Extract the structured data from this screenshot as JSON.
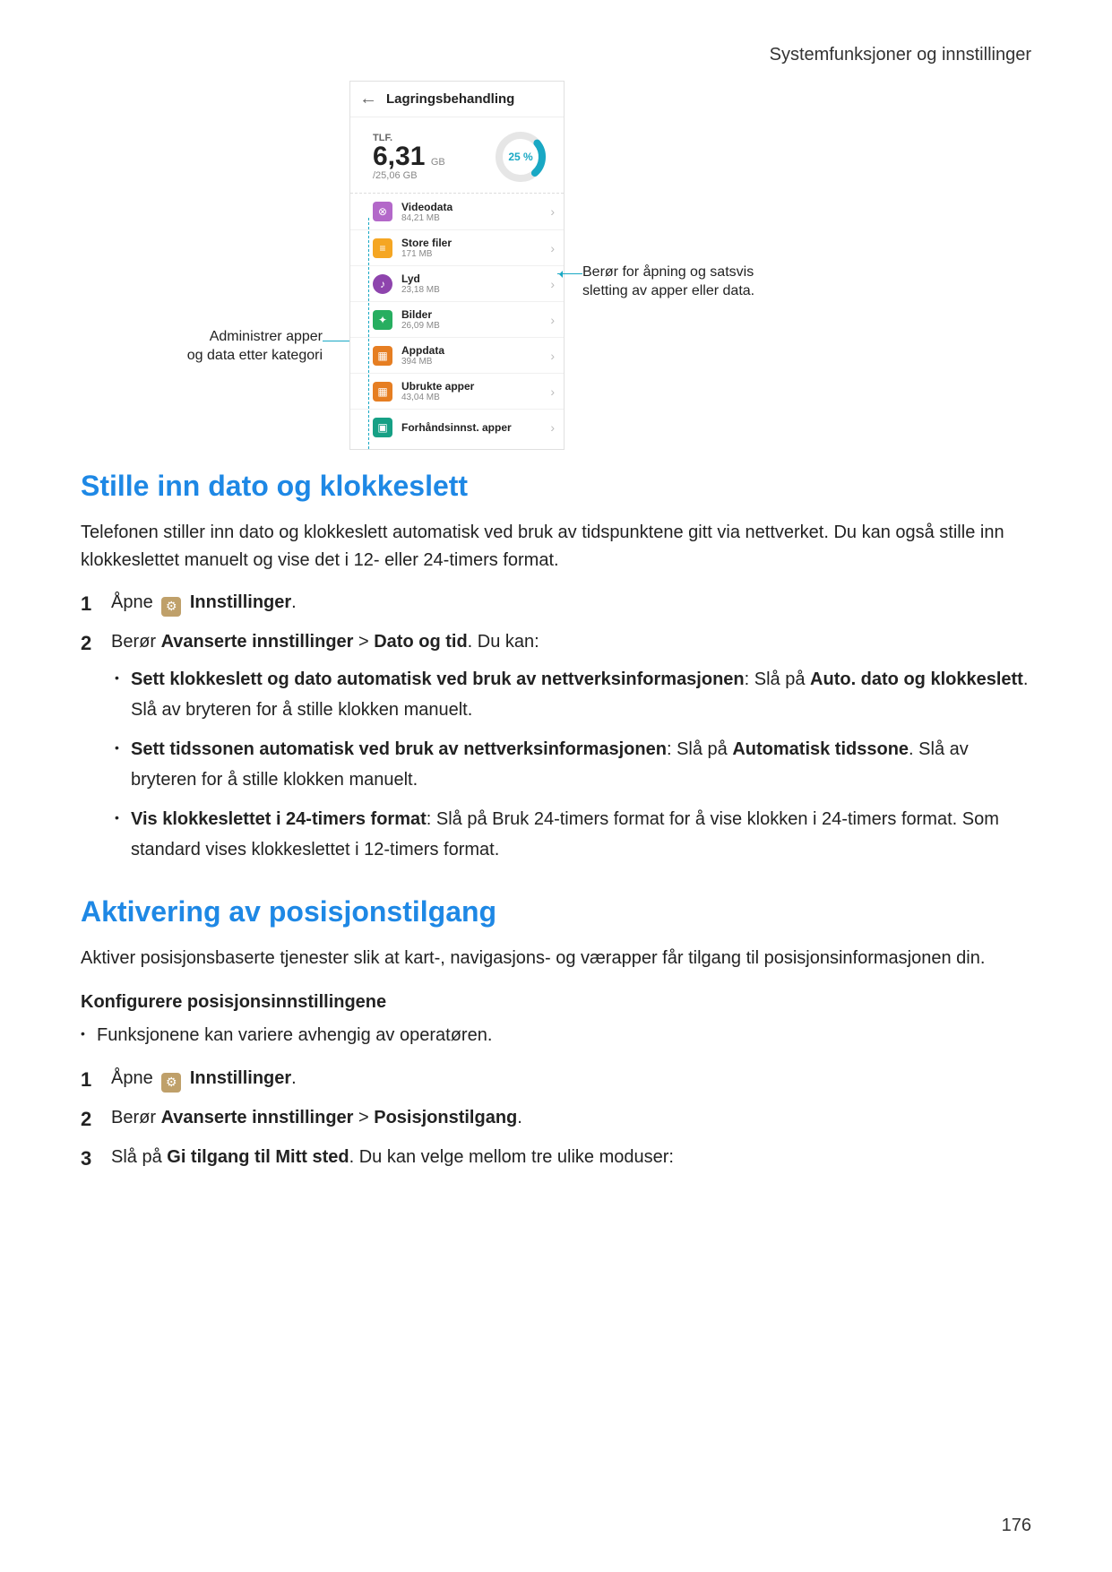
{
  "header": {
    "section": "Systemfunksjoner og innstillinger"
  },
  "page_number": "176",
  "diagram": {
    "label_manage_line1": "Administrer apper",
    "label_manage_line2": "og data etter kategori",
    "label_delete_line1": "Berør for åpning og satsvis",
    "label_delete_line2": "sletting av apper eller data.",
    "phone": {
      "title": "Lagringsbehandling",
      "storage_label": "TLF.",
      "used": "6,31",
      "unit": "GB",
      "total": "/25,06 GB",
      "percent": "25 %",
      "items": [
        {
          "name": "Videodata",
          "sub": "84,21 MB",
          "icon": "video"
        },
        {
          "name": "Store filer",
          "sub": "171 MB",
          "icon": "files"
        },
        {
          "name": "Lyd",
          "sub": "23,18 MB",
          "icon": "audio"
        },
        {
          "name": "Bilder",
          "sub": "26,09 MB",
          "icon": "img"
        },
        {
          "name": "Appdata",
          "sub": "394 MB",
          "icon": "app"
        },
        {
          "name": "Ubrukte apper",
          "sub": "43,04 MB",
          "icon": "unused"
        },
        {
          "name": "Forhåndsinnst. apper",
          "sub": "",
          "icon": "pre"
        }
      ]
    }
  },
  "s1": {
    "title": "Stille inn dato og klokkeslett",
    "p1": "Telefonen stiller inn dato og klokkeslett automatisk ved bruk av tidspunktene gitt via nettverket. Du kan også stille inn klokkeslettet manuelt og vise det i 12- eller 24-timers format.",
    "step1_a": "Åpne ",
    "step1_b": "Innstillinger",
    "step1_c": ".",
    "step2_a": "Berør ",
    "step2_b": "Avanserte innstillinger",
    "step2_c": " > ",
    "step2_d": "Dato og tid",
    "step2_e": ". Du kan:",
    "b1_a": "Sett klokkeslett og dato automatisk ved bruk av nettverksinformasjonen",
    "b1_b": ": Slå på ",
    "b1_c": "Auto. dato og klokkeslett",
    "b1_d": ". Slå av bryteren for å stille klokken manuelt.",
    "b2_a": "Sett tidssonen automatisk ved bruk av nettverksinformasjonen",
    "b2_b": ": Slå på ",
    "b2_c": "Automatisk tidssone",
    "b2_d": ". Slå av bryteren for å stille klokken manuelt.",
    "b3_a": "Vis klokkeslettet i 24-timers format",
    "b3_b": ": Slå på Bruk 24-timers format for å vise klokken i 24-timers format. Som standard vises klokkeslettet i 12-timers format."
  },
  "s2": {
    "title": "Aktivering av posisjonstilgang",
    "p1": "Aktiver posisjonsbaserte tjenester slik at kart-, navigasjons- og værapper får tilgang til posisjonsinformasjonen din.",
    "sub": "Konfigurere posisjonsinnstillingene",
    "note": "Funksjonene kan variere avhengig av operatøren.",
    "step1_a": "Åpne ",
    "step1_b": "Innstillinger",
    "step1_c": ".",
    "step2_a": "Berør ",
    "step2_b": "Avanserte innstillinger",
    "step2_c": " > ",
    "step2_d": "Posisjonstilgang",
    "step2_e": ".",
    "step3_a": "Slå på ",
    "step3_b": "Gi tilgang til Mitt sted",
    "step3_c": ". Du kan velge mellom tre ulike moduser:"
  }
}
